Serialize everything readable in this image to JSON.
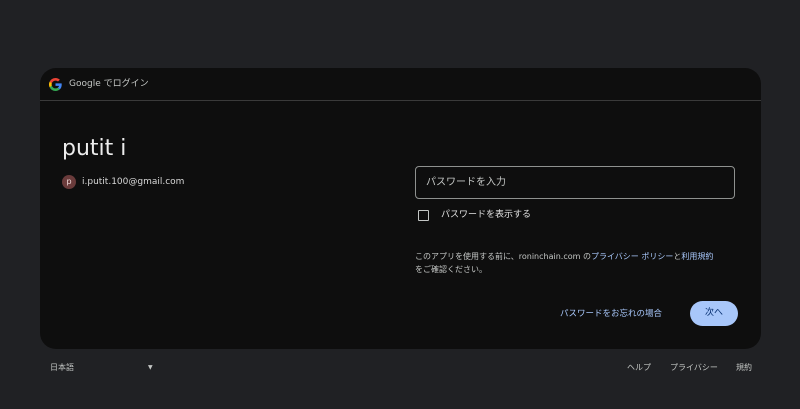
{
  "header": {
    "title": "Google でログイン"
  },
  "account": {
    "name": "putit i",
    "avatar_letter": "p",
    "email": "i.putit.100@gmail.com"
  },
  "form": {
    "password_placeholder": "パスワードを入力",
    "show_password_label": "パスワードを表示する",
    "notice_prefix": "このアプリを使用する前に、roninchain.com の",
    "privacy_policy_link": "プライバシー ポリシー",
    "notice_and": "と",
    "terms_link": "利用規約",
    "notice_suffix": "をご確認ください。",
    "forgot_password_link": "パスワードをお忘れの場合",
    "next_button": "次へ"
  },
  "footer": {
    "language": "日本語",
    "help": "ヘルプ",
    "privacy": "プライバシー",
    "terms": "規約"
  },
  "colors": {
    "background": "#202124",
    "card": "#0e0e0e",
    "accent": "#a8c7fa",
    "button_text": "#062e6f"
  }
}
